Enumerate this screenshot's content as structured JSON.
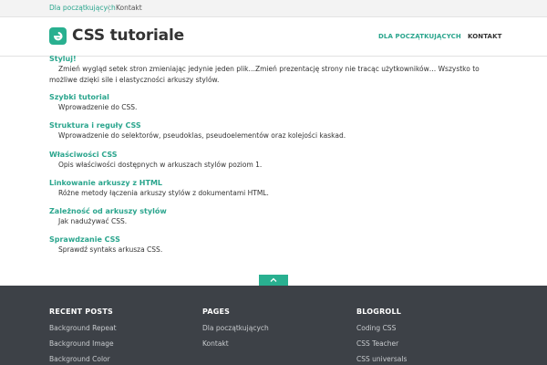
{
  "topbar": {
    "links": [
      "Dla początkujących",
      "Kontakt"
    ]
  },
  "header": {
    "site_title": "CSS tutoriale",
    "nav": [
      "Dla początkujących",
      "Kontakt"
    ]
  },
  "entries": [
    {
      "title": "Styluj!",
      "desc": "Zmień wygląd setek stron zmieniając jedynie jeden plik…Zmień prezentację strony nie tracąc użytkowników… Wszystko to możliwe dzięki sile i elastyczności arkuszy stylów."
    },
    {
      "title": "Szybki tutorial",
      "desc": "Wprowadzenie do CSS."
    },
    {
      "title": "Struktura i reguły CSS",
      "desc": "Wprowadzenie do selektorów, pseudoklas, pseudoelementów oraz kolejości kaskad."
    },
    {
      "title": "Właściwości CSS",
      "desc": "Opis właściwości dostępnych w arkuszach stylów poziom 1."
    },
    {
      "title": "Linkowanie arkuszy z HTML",
      "desc": "Różne metody łączenia arkuszy stylów z dokumentami HTML."
    },
    {
      "title": "Zależność od arkuszy stylów",
      "desc": "Jak nadużywać CSS."
    },
    {
      "title": "Sprawdzanie CSS",
      "desc": "Sprawdź syntaks arkusza CSS."
    }
  ],
  "scroll_top_icon": "chevron-up-icon",
  "footer": {
    "columns": [
      {
        "heading": "Recent Posts",
        "links": [
          "Background Repeat",
          "Background Image",
          "Background Color"
        ]
      },
      {
        "heading": "Pages",
        "links": [
          "Dla początkujących",
          "Kontakt"
        ]
      },
      {
        "heading": "Blogroll",
        "links": [
          "Coding CSS",
          "CSS Teacher",
          "CSS universals"
        ]
      }
    ]
  },
  "colors": {
    "accent": "#29b090",
    "footer_bg": "#3d4147",
    "topbar_bg": "#f3f3f3"
  }
}
